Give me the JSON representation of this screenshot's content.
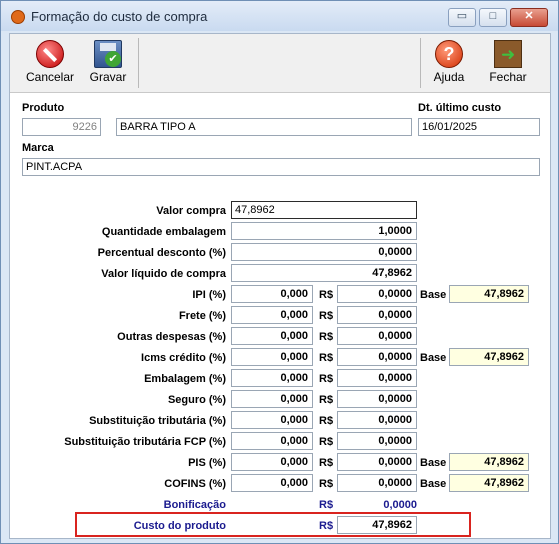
{
  "window": {
    "title": "Formação do custo de compra",
    "controls": {
      "minimize": "▭",
      "maximize": "□",
      "close": "✕"
    }
  },
  "toolbar": {
    "cancel_label": "Cancelar",
    "save_label": "Gravar",
    "help_label": "Ajuda",
    "help_glyph": "?",
    "close_label": "Fechar"
  },
  "header": {
    "produto_label": "Produto",
    "produto_code": "9226",
    "produto_name": "BARRA TIPO A",
    "dt_label": "Dt. último custo",
    "dt_value": "16/01/2025",
    "marca_label": "Marca",
    "marca_value": "PINT.ACPA"
  },
  "currency": "R$",
  "base_label": "Base",
  "rows": {
    "valor_compra": {
      "label": "Valor compra",
      "value": "47,8962"
    },
    "qtd_embalagem": {
      "label": "Quantidade embalagem",
      "value": "1,0000"
    },
    "perc_desconto": {
      "label": "Percentual desconto (%)",
      "value": "0,0000"
    },
    "valor_liquido": {
      "label": "Valor líquido de compra",
      "value": "47,8962"
    },
    "ipi": {
      "label": "IPI (%)",
      "pct": "0,000",
      "value": "0,0000",
      "base": "47,8962"
    },
    "frete": {
      "label": "Frete (%)",
      "pct": "0,000",
      "value": "0,0000"
    },
    "outras": {
      "label": "Outras despesas (%)",
      "pct": "0,000",
      "value": "0,0000"
    },
    "icms": {
      "label": "Icms crédito (%)",
      "pct": "0,000",
      "value": "0,0000",
      "base": "47,8962"
    },
    "embalagem": {
      "label": "Embalagem (%)",
      "pct": "0,000",
      "value": "0,0000"
    },
    "seguro": {
      "label": "Seguro (%)",
      "pct": "0,000",
      "value": "0,0000"
    },
    "st": {
      "label": "Substituição tributária (%)",
      "pct": "0,000",
      "value": "0,0000"
    },
    "st_fcp": {
      "label": "Substituição tributária FCP (%)",
      "pct": "0,000",
      "value": "0,0000"
    },
    "pis": {
      "label": "PIS (%)",
      "pct": "0,000",
      "value": "0,0000",
      "base": "47,8962"
    },
    "cofins": {
      "label": "COFINS (%)",
      "pct": "0,000",
      "value": "0,0000",
      "base": "47,8962"
    },
    "bonificacao": {
      "label": "Bonificação",
      "value": "0,0000"
    },
    "custo": {
      "label": "Custo do produto",
      "value": "47,8962"
    }
  },
  "colors": {
    "highlight": "#d9241f",
    "label_blue": "#1b1b8f",
    "base_bg": "#ffffe1"
  }
}
